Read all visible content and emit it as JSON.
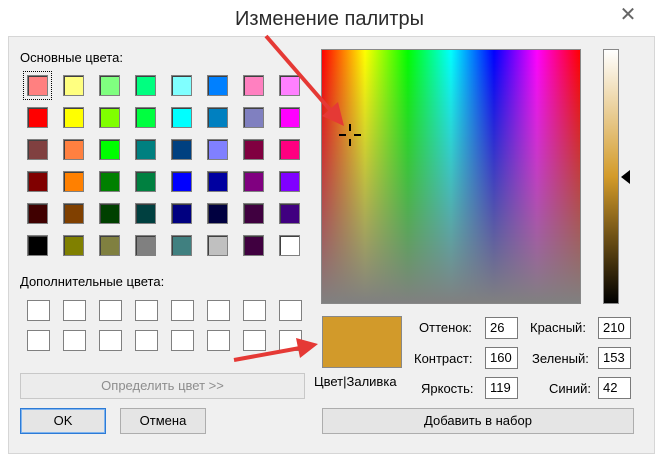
{
  "window": {
    "title": "Изменение палитры",
    "close_label": "✕"
  },
  "basic_colors": {
    "label": "Основные цвета:",
    "rows": [
      [
        "#ff8080",
        "#ffff80",
        "#80ff80",
        "#00ff80",
        "#80ffff",
        "#0080ff",
        "#ff80c0",
        "#ff80ff"
      ],
      [
        "#ff0000",
        "#ffff00",
        "#80ff00",
        "#00ff40",
        "#00ffff",
        "#0080c0",
        "#8080c0",
        "#ff00ff"
      ],
      [
        "#804040",
        "#ff8040",
        "#00ff00",
        "#008080",
        "#004080",
        "#8080ff",
        "#800040",
        "#ff0080"
      ],
      [
        "#800000",
        "#ff8000",
        "#008000",
        "#008040",
        "#0000ff",
        "#0000a0",
        "#800080",
        "#8000ff"
      ],
      [
        "#400000",
        "#804000",
        "#004000",
        "#004040",
        "#000080",
        "#000040",
        "#400040",
        "#400080"
      ],
      [
        "#000000",
        "#808000",
        "#808040",
        "#808080",
        "#408080",
        "#c0c0c0",
        "#400040",
        "#ffffff"
      ]
    ]
  },
  "custom_colors": {
    "label": "Дополнительные цвета:"
  },
  "buttons": {
    "define": "Определить цвет >>",
    "ok": "OK",
    "cancel": "Отмена",
    "add": "Добавить в набор"
  },
  "preview": {
    "label": "Цвет|Заливка",
    "color": "#d29a2a"
  },
  "fields": {
    "hue_label": "Оттенок:",
    "hue": "26",
    "sat_label": "Контраст:",
    "sat": "160",
    "lum_label": "Яркость:",
    "lum": "119",
    "red_label": "Красный:",
    "red": "210",
    "green_label": "Зеленый:",
    "green": "153",
    "blue_label": "Синий:",
    "blue": "42"
  },
  "accent": "#e53935"
}
